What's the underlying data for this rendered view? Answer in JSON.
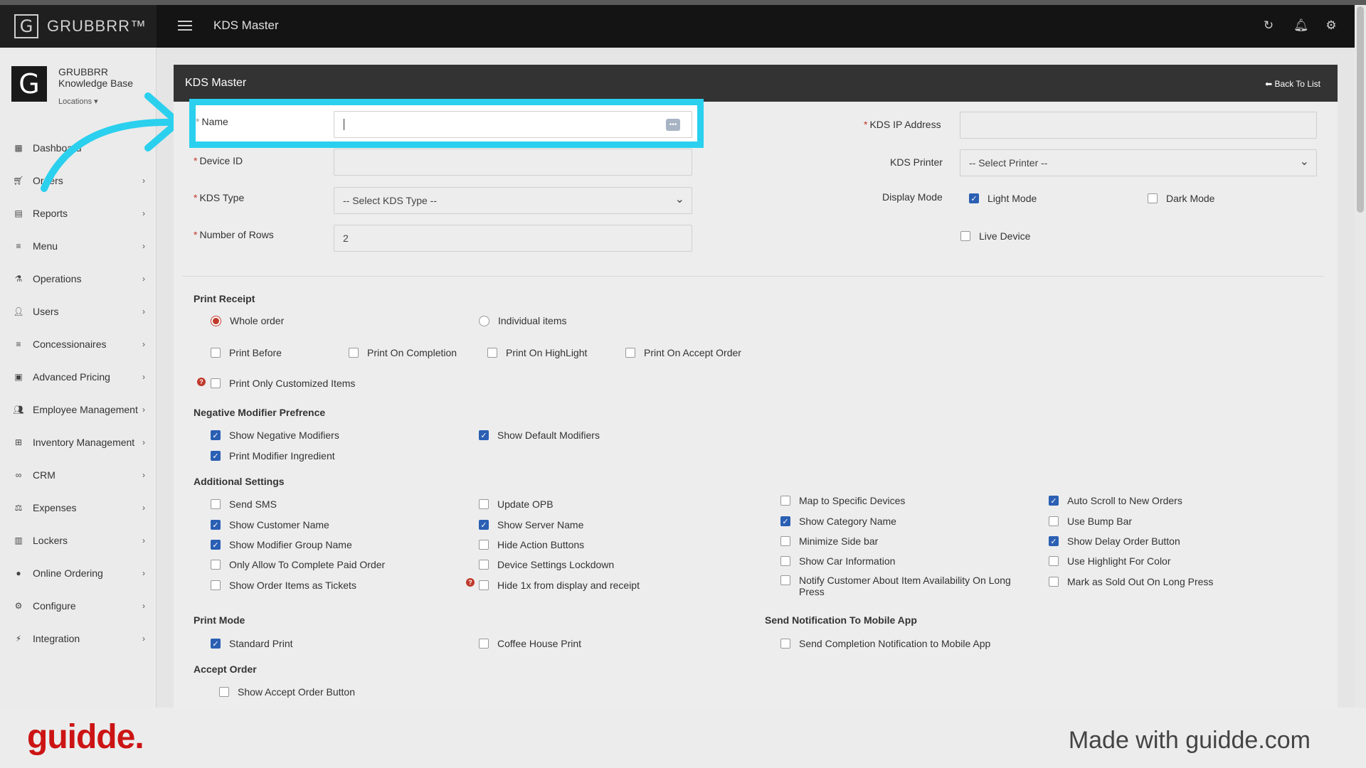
{
  "app": {
    "brand": "GRUBBRR™",
    "page_title": "KDS Master"
  },
  "sidebar": {
    "org_line1": "GRUBBRR",
    "org_line2": "Knowledge Base",
    "locations": "Locations ▾",
    "items": [
      {
        "label": "Dashboard",
        "icon": "dashboard-icon"
      },
      {
        "label": "Orders",
        "icon": "cart-icon"
      },
      {
        "label": "Reports",
        "icon": "report-icon"
      },
      {
        "label": "Menu",
        "icon": "menu-icon"
      },
      {
        "label": "Operations",
        "icon": "flask-icon"
      },
      {
        "label": "Users",
        "icon": "user-add-icon"
      },
      {
        "label": "Concessionaires",
        "icon": "list-icon"
      },
      {
        "label": "Advanced Pricing",
        "icon": "money-icon"
      },
      {
        "label": "Employee Management",
        "icon": "users-icon"
      },
      {
        "label": "Inventory Management",
        "icon": "sitemap-icon"
      },
      {
        "label": "CRM",
        "icon": "link-icon"
      },
      {
        "label": "Expenses",
        "icon": "scale-icon"
      },
      {
        "label": "Lockers",
        "icon": "locker-icon"
      },
      {
        "label": "Online Ordering",
        "icon": "globe-icon"
      },
      {
        "label": "Configure",
        "icon": "cog-icon"
      },
      {
        "label": "Integration",
        "icon": "plug-icon"
      }
    ]
  },
  "panel": {
    "title": "KDS Master",
    "back": "Back To List",
    "name_label": "Name",
    "device_id_label": "Device ID",
    "kds_type_label": "KDS Type",
    "kds_type_value": "-- Select KDS Type --",
    "rows_label": "Number of Rows",
    "rows_value": "2",
    "ip_label": "KDS IP Address",
    "printer_label": "KDS Printer",
    "printer_value": "-- Select Printer --",
    "display_mode_label": "Display Mode",
    "light_mode": "Light Mode",
    "dark_mode": "Dark Mode",
    "live_device": "Live Device"
  },
  "print_receipt": {
    "title": "Print Receipt",
    "whole_order": "Whole order",
    "individual_items": "Individual items",
    "print_before": "Print Before",
    "print_on_completion": "Print On Completion",
    "print_on_highlight": "Print On HighLight",
    "print_on_accept": "Print On Accept Order",
    "print_only_customized": "Print Only Customized Items"
  },
  "negative_modifier": {
    "title": "Negative Modifier Prefrence",
    "show_negative": "Show Negative Modifiers",
    "show_default": "Show Default Modifiers",
    "print_ingredient": "Print Modifier Ingredient"
  },
  "additional": {
    "title": "Additional Settings",
    "col1": [
      {
        "label": "Send SMS",
        "checked": false
      },
      {
        "label": "Show Customer Name",
        "checked": true
      },
      {
        "label": "Show Modifier Group Name",
        "checked": true
      },
      {
        "label": "Only Allow To Complete Paid Order",
        "checked": false
      },
      {
        "label": "Show Order Items as Tickets",
        "checked": false
      }
    ],
    "col2": [
      {
        "label": "Update OPB",
        "checked": false
      },
      {
        "label": "Show Server Name",
        "checked": true
      },
      {
        "label": "Hide Action Buttons",
        "checked": false
      },
      {
        "label": "Device Settings Lockdown",
        "checked": false
      },
      {
        "label": "Hide 1x from display and receipt",
        "checked": false
      }
    ],
    "col3": [
      {
        "label": "Map to Specific Devices",
        "checked": false
      },
      {
        "label": "Show Category Name",
        "checked": true
      },
      {
        "label": "Minimize Side bar",
        "checked": false
      },
      {
        "label": "Show Car Information",
        "checked": false
      },
      {
        "label": "Notify Customer About Item Availability On Long",
        "label2": "Press",
        "checked": false
      }
    ],
    "col4": [
      {
        "label": "Auto Scroll to New Orders",
        "checked": true
      },
      {
        "label": "Use Bump Bar",
        "checked": false
      },
      {
        "label": "Show Delay Order Button",
        "checked": true
      },
      {
        "label": "Use Highlight For Color",
        "checked": false
      },
      {
        "label": "Mark as Sold Out On Long Press",
        "checked": false
      }
    ]
  },
  "print_mode": {
    "title": "Print Mode",
    "standard": "Standard Print",
    "coffee": "Coffee House Print"
  },
  "notification": {
    "title": "Send Notification To Mobile App",
    "completion": "Send Completion Notification to Mobile App"
  },
  "accept_order": {
    "title": "Accept Order",
    "show_button": "Show Accept Order Button"
  },
  "footer": {
    "brand": "guidde.",
    "made_with": "Made with guidde.com"
  },
  "colors": {
    "highlight": "#2ad0ee",
    "check": "#2b5fb3",
    "required": "#c0392b",
    "brand_red": "#cc1414"
  }
}
